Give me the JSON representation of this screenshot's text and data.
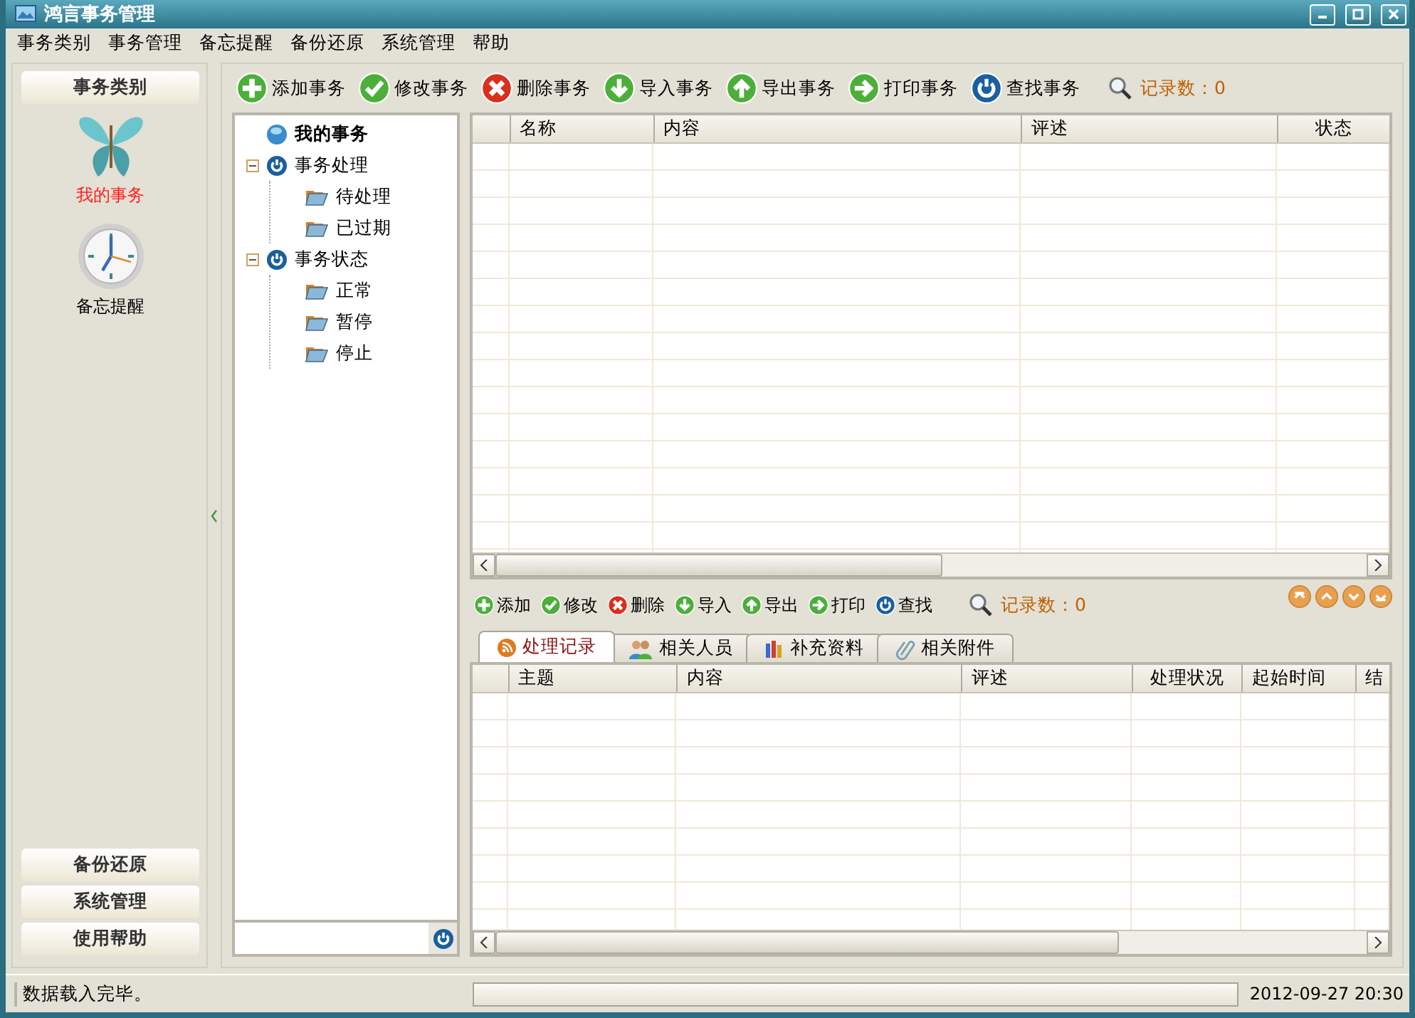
{
  "window": {
    "title": "鸿言事务管理"
  },
  "menu": [
    "事务类别",
    "事务管理",
    "备忘提醒",
    "备份还原",
    "系统管理",
    "帮助"
  ],
  "sidebar": {
    "header": "事务类别",
    "items": [
      {
        "kind": "butterfly",
        "label": "我的事务",
        "selected": true
      },
      {
        "kind": "clock",
        "label": "备忘提醒",
        "selected": false
      }
    ],
    "buttons": [
      "备份还原",
      "系统管理",
      "使用帮助"
    ]
  },
  "toolbar": {
    "buttons": [
      {
        "kind": "add",
        "label": "添加事务"
      },
      {
        "kind": "edit",
        "label": "修改事务"
      },
      {
        "kind": "delete",
        "label": "删除事务"
      },
      {
        "kind": "import",
        "label": "导入事务"
      },
      {
        "kind": "export",
        "label": "导出事务"
      },
      {
        "kind": "print",
        "label": "打印事务"
      },
      {
        "kind": "find",
        "label": "查找事务"
      }
    ],
    "record_count": "记录数：0"
  },
  "tree": {
    "items": [
      {
        "kind": "root",
        "label": "我的事务"
      },
      {
        "kind": "group",
        "label": "事务处理",
        "expanded": true,
        "children": [
          {
            "kind": "folder",
            "label": "待处理"
          },
          {
            "kind": "folder",
            "label": "已过期"
          }
        ]
      },
      {
        "kind": "group",
        "label": "事务状态",
        "expanded": true,
        "children": [
          {
            "kind": "folder",
            "label": "正常"
          },
          {
            "kind": "folder",
            "label": "暂停"
          },
          {
            "kind": "folder",
            "label": "停止"
          }
        ]
      }
    ]
  },
  "grid": {
    "columns": [
      "名称",
      "内容",
      "评述",
      "状态"
    ]
  },
  "detail_toolbar": {
    "buttons": [
      {
        "kind": "add",
        "label": "添加"
      },
      {
        "kind": "edit",
        "label": "修改"
      },
      {
        "kind": "delete",
        "label": "删除"
      },
      {
        "kind": "import",
        "label": "导入"
      },
      {
        "kind": "export",
        "label": "导出"
      },
      {
        "kind": "print",
        "label": "打印"
      },
      {
        "kind": "find",
        "label": "查找"
      }
    ],
    "record_count": "记录数：0"
  },
  "tabs": [
    {
      "kind": "feed",
      "label": "处理记录",
      "selected": true
    },
    {
      "kind": "people",
      "label": "相关人员",
      "selected": false
    },
    {
      "kind": "books",
      "label": "补充资料",
      "selected": false
    },
    {
      "kind": "clip",
      "label": "相关附件",
      "selected": false
    }
  ],
  "detail_grid": {
    "columns": [
      "主题",
      "内容",
      "评述",
      "处理状况",
      "起始时间",
      "结"
    ]
  },
  "status_bar": {
    "message": "数据载入完毕。",
    "progress": {
      "level": 0
    },
    "datetime": "2012-09-27 20:30"
  }
}
